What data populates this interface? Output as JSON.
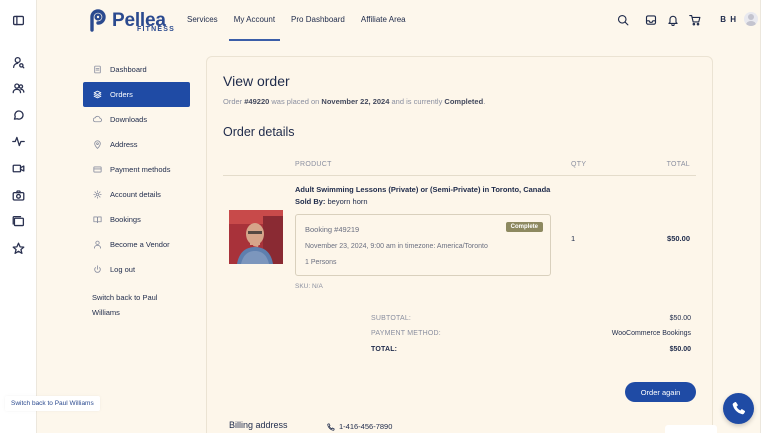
{
  "brand": {
    "name": "Pellea",
    "sub": "FITNESS",
    "accent": "#1f4ba5"
  },
  "nav": {
    "items": [
      {
        "label": "Services"
      },
      {
        "label": "My Account"
      },
      {
        "label": "Pro Dashboard"
      },
      {
        "label": "Affiliate Area"
      }
    ],
    "active": "My Account"
  },
  "header": {
    "icons": [
      "search-icon",
      "inbox-icon",
      "bell-icon",
      "cart-icon"
    ],
    "initials": "B H"
  },
  "rail": {
    "icons": [
      "sidebar-toggle-icon",
      "user-search-icon",
      "users-icon",
      "chat-icon",
      "activity-icon",
      "video-icon",
      "camera-icon",
      "folder-icon",
      "star-icon"
    ]
  },
  "sidebar": {
    "items": [
      {
        "label": "Dashboard",
        "icon": "dashboard-icon"
      },
      {
        "label": "Orders",
        "icon": "orders-icon"
      },
      {
        "label": "Downloads",
        "icon": "download-icon"
      },
      {
        "label": "Address",
        "icon": "location-icon"
      },
      {
        "label": "Payment methods",
        "icon": "card-icon"
      },
      {
        "label": "Account details",
        "icon": "gear-icon"
      },
      {
        "label": "Bookings",
        "icon": "book-icon"
      },
      {
        "label": "Become a Vendor",
        "icon": "user-icon"
      },
      {
        "label": "Log out",
        "icon": "power-icon"
      }
    ],
    "active": "Orders",
    "switch_link": "Switch back to Paul Williams"
  },
  "order": {
    "title": "View order",
    "placed_prefix": "Order ",
    "number": "#49220",
    "placed_mid": " was placed on ",
    "date": "November 22, 2024",
    "status_mid": " and is currently ",
    "status": "Completed",
    "status_end": "."
  },
  "details": {
    "title": "Order details",
    "columns": {
      "product": "PRODUCT",
      "qty": "QTY",
      "total": "TOTAL"
    },
    "item": {
      "name": "Adult Swimming Lessons (Private) or (Semi-Private) in Toronto, Canada",
      "sold_by_label": "Sold By:",
      "vendor": "beyorn horn",
      "booking_title": "Booking #49219",
      "booking_status": "Complete",
      "booking_date": "November 23, 2024, 9:00 am in timezone: America/Toronto",
      "persons": "1 Persons",
      "sku": "SKU: N/A",
      "qty": "1",
      "total": "$50.00"
    },
    "summary": [
      {
        "label": "SUBTOTAL:",
        "value": "$50.00"
      },
      {
        "label": "PAYMENT METHOD:",
        "value": "WooCommerce Bookings"
      },
      {
        "label": "TOTAL:",
        "value": "$50.00"
      }
    ],
    "again_button": "Order again"
  },
  "billing": {
    "title": "Billing address",
    "phone": "1-416-456-7890"
  },
  "floating": {
    "switch_back": "Switch back to Paul Williams"
  }
}
